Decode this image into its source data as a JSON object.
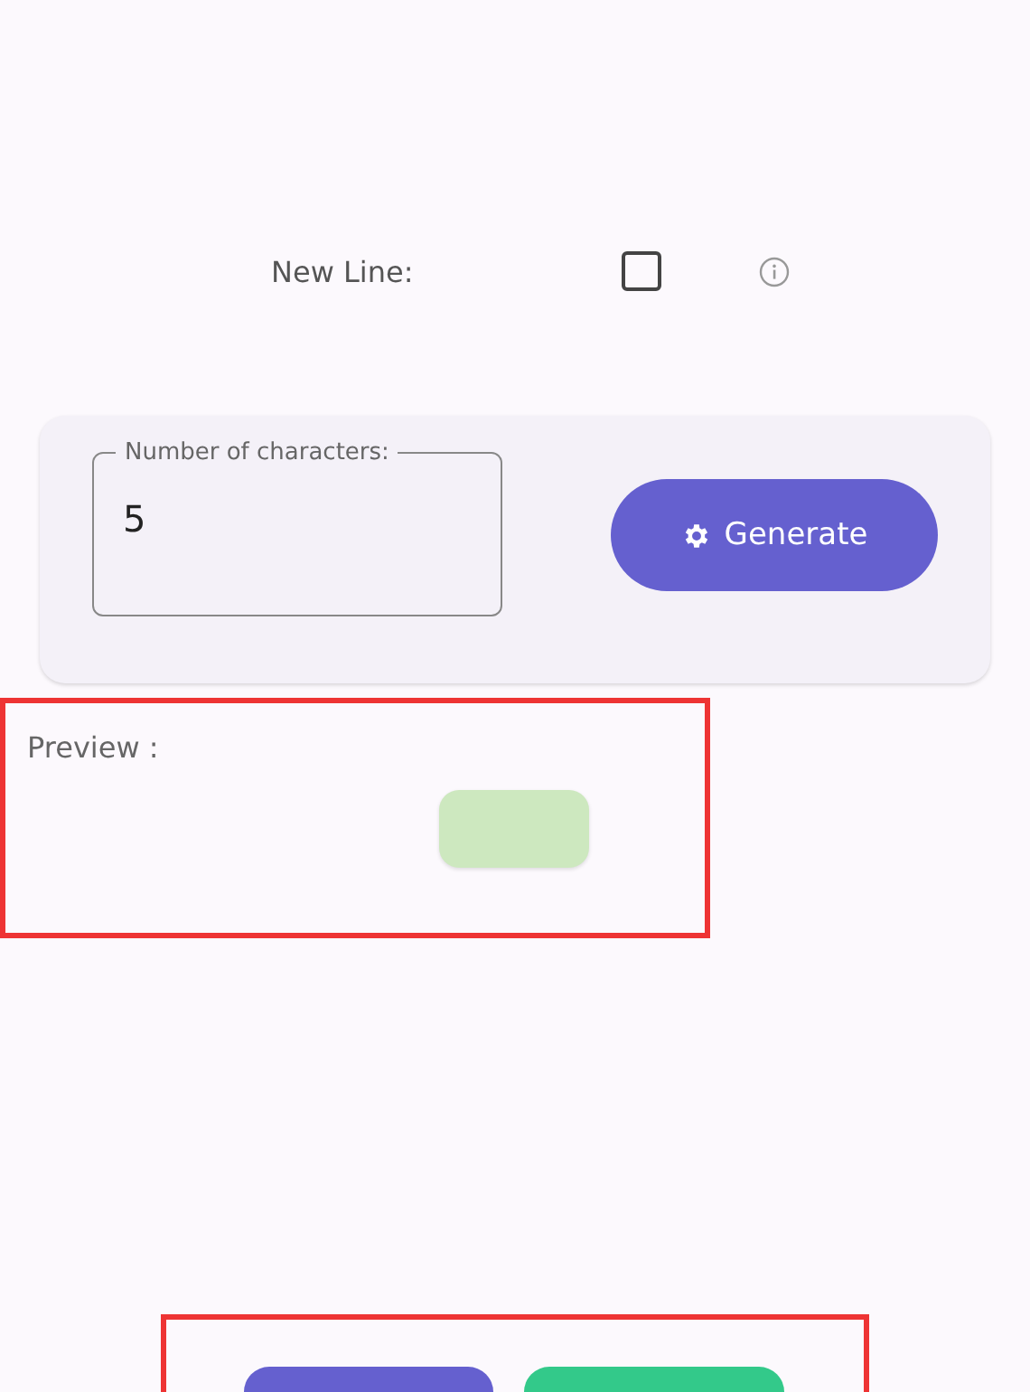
{
  "new_line": {
    "label": "New Line:",
    "checked": false
  },
  "count_field": {
    "label": "Number of characters:",
    "value": "5"
  },
  "generate_button": {
    "label": "Generate"
  },
  "preview": {
    "label": "Preview :"
  },
  "bottom_buttons": [
    {
      "color": "#6560cf"
    },
    {
      "color": "#33c98a"
    }
  ]
}
